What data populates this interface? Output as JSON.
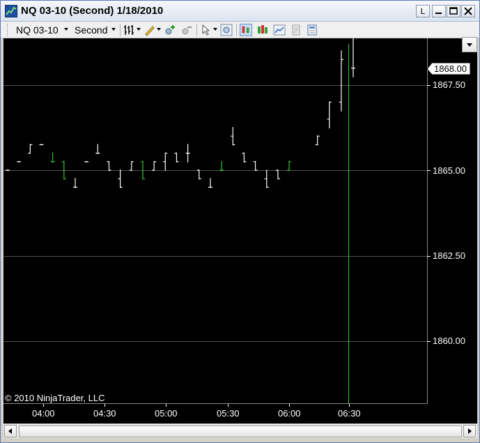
{
  "window": {
    "title": "NQ 03-10 (Second)  1/18/2010",
    "buttons": {
      "left_label": "L",
      "min_icon": "minimize-icon",
      "max_icon": "maximize-icon",
      "close_icon": "close-icon"
    }
  },
  "toolbar": {
    "instrument": "NQ 03-10",
    "period": "Second",
    "icons": [
      "bar-style-icon",
      "drawing-pencil-icon",
      "zoom-in-icon",
      "zoom-out-icon",
      "pointer-icon",
      "magnifier-icon",
      "chart-style-bar-icon",
      "chart-style-candle-icon",
      "chart-style-line-icon",
      "properties-icon",
      "data-box-icon"
    ]
  },
  "chart": {
    "current_price": "1868.00",
    "copyright": "© 2010 NinjaTrader, LLC",
    "price_labels": [
      "1867.50",
      "1865.00",
      "1862.50",
      "1860.00"
    ],
    "time_labels": [
      "04:00",
      "04:30",
      "05:00",
      "05:30",
      "06:00",
      "06:30"
    ],
    "colors": {
      "background": "#000000",
      "up_bar": "#ffffff",
      "down_bar": "#2ecc2e",
      "grid": "#505050",
      "crosshair": "#2ecc2e"
    }
  },
  "chart_data": {
    "type": "bar",
    "title": "NQ 03-10 (Second)  1/18/2010",
    "ylim": [
      1858.5,
      1869.5
    ],
    "yticks": [
      1860.0,
      1862.5,
      1865.0,
      1867.5
    ],
    "xticks": [
      "04:00",
      "04:30",
      "05:00",
      "05:30",
      "06:00",
      "06:30"
    ],
    "current_price": 1868.0,
    "bars": [
      {
        "x": 0,
        "o": 1865.0,
        "h": 1865.0,
        "l": 1865.0,
        "c": 1865.0,
        "up": true
      },
      {
        "x": 1,
        "o": 1865.25,
        "h": 1865.25,
        "l": 1865.25,
        "c": 1865.25,
        "up": true
      },
      {
        "x": 2,
        "o": 1865.5,
        "h": 1865.75,
        "l": 1865.5,
        "c": 1865.75,
        "up": true
      },
      {
        "x": 3,
        "o": 1865.75,
        "h": 1865.75,
        "l": 1865.75,
        "c": 1865.75,
        "up": true
      },
      {
        "x": 4,
        "o": 1865.25,
        "h": 1865.5,
        "l": 1865.25,
        "c": 1865.25,
        "up": false
      },
      {
        "x": 5,
        "o": 1865.25,
        "h": 1865.25,
        "l": 1864.75,
        "c": 1864.75,
        "up": false
      },
      {
        "x": 6,
        "o": 1864.5,
        "h": 1864.75,
        "l": 1864.5,
        "c": 1864.5,
        "up": true
      },
      {
        "x": 7,
        "o": 1865.25,
        "h": 1865.25,
        "l": 1865.25,
        "c": 1865.25,
        "up": true
      },
      {
        "x": 8,
        "o": 1865.5,
        "h": 1865.75,
        "l": 1865.5,
        "c": 1865.5,
        "up": true
      },
      {
        "x": 9,
        "o": 1865.25,
        "h": 1865.25,
        "l": 1865.0,
        "c": 1865.0,
        "up": true
      },
      {
        "x": 10,
        "o": 1864.75,
        "h": 1865.0,
        "l": 1864.5,
        "c": 1864.5,
        "up": true
      },
      {
        "x": 11,
        "o": 1865.0,
        "h": 1865.25,
        "l": 1865.0,
        "c": 1865.25,
        "up": true
      },
      {
        "x": 12,
        "o": 1865.25,
        "h": 1865.25,
        "l": 1864.75,
        "c": 1864.75,
        "up": false
      },
      {
        "x": 13,
        "o": 1865.0,
        "h": 1865.25,
        "l": 1865.0,
        "c": 1865.25,
        "up": true
      },
      {
        "x": 14,
        "o": 1865.25,
        "h": 1865.5,
        "l": 1865.0,
        "c": 1865.5,
        "up": true
      },
      {
        "x": 15,
        "o": 1865.5,
        "h": 1865.5,
        "l": 1865.25,
        "c": 1865.25,
        "up": true
      },
      {
        "x": 16,
        "o": 1865.5,
        "h": 1865.75,
        "l": 1865.25,
        "c": 1865.5,
        "up": true
      },
      {
        "x": 17,
        "o": 1865.0,
        "h": 1865.0,
        "l": 1864.75,
        "c": 1864.75,
        "up": true
      },
      {
        "x": 18,
        "o": 1864.5,
        "h": 1864.75,
        "l": 1864.5,
        "c": 1864.5,
        "up": true
      },
      {
        "x": 19,
        "o": 1865.0,
        "h": 1865.25,
        "l": 1865.0,
        "c": 1865.0,
        "up": false
      },
      {
        "x": 20,
        "o": 1866.0,
        "h": 1866.25,
        "l": 1865.75,
        "c": 1865.75,
        "up": true
      },
      {
        "x": 21,
        "o": 1865.5,
        "h": 1865.5,
        "l": 1865.25,
        "c": 1865.25,
        "up": true
      },
      {
        "x": 22,
        "o": 1865.25,
        "h": 1865.25,
        "l": 1865.0,
        "c": 1865.0,
        "up": true
      },
      {
        "x": 23,
        "o": 1864.75,
        "h": 1865.0,
        "l": 1864.5,
        "c": 1864.5,
        "up": true
      },
      {
        "x": 24,
        "o": 1865.0,
        "h": 1865.0,
        "l": 1864.75,
        "c": 1864.75,
        "up": true
      },
      {
        "x": 25,
        "o": 1865.0,
        "h": 1865.25,
        "l": 1865.0,
        "c": 1865.25,
        "up": false
      },
      {
        "x": 26,
        "o": 1865.75,
        "h": 1866.0,
        "l": 1865.75,
        "c": 1866.0,
        "up": true
      },
      {
        "x": 27,
        "o": 1866.5,
        "h": 1867.0,
        "l": 1866.25,
        "c": 1867.0,
        "up": true
      },
      {
        "x": 28,
        "o": 1867.0,
        "h": 1868.5,
        "l": 1866.75,
        "c": 1868.25,
        "up": true
      },
      {
        "x": 29,
        "o": 1868.0,
        "h": 1869.0,
        "l": 1867.75,
        "c": 1868.0,
        "up": true
      }
    ]
  }
}
